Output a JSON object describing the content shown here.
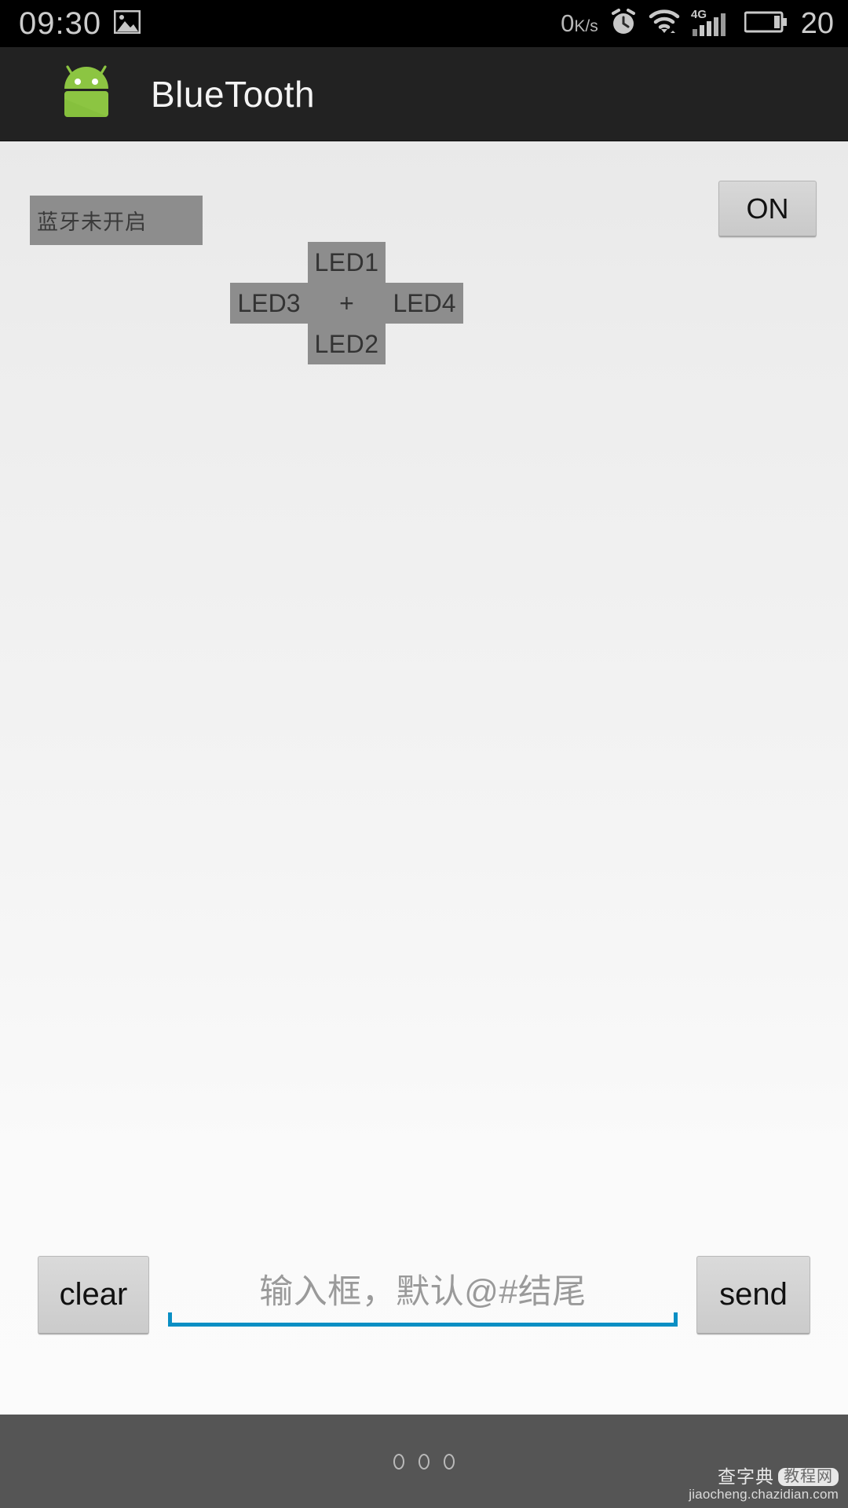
{
  "statusbar": {
    "clock": "09:30",
    "gallery_icon": "image-icon",
    "net_speed_value": "0",
    "net_speed_unit": "K/s",
    "alarm_icon": "alarm-clock-icon",
    "wifi_icon": "wifi-icon",
    "network_type": "4G",
    "signal_icon": "signal-bars-icon",
    "battery_icon": "battery-icon",
    "battery_level": "20"
  },
  "appbar": {
    "logo_icon": "android-robot-icon",
    "title": "BlueTooth"
  },
  "main": {
    "bluetooth_status": "蓝牙未开启",
    "power_button": "ON",
    "dpad": {
      "up": "LED1",
      "down": "LED2",
      "left": "LED3",
      "right": "LED4",
      "center": "+"
    }
  },
  "input_row": {
    "clear_button": "clear",
    "send_button": "send",
    "edit_placeholder": "输入框，默认@#结尾",
    "underline_color": "#0a8fc4"
  },
  "navbar": {
    "menu_icon": "three-dots-icon",
    "watermark_brand": "查字典",
    "watermark_badge": "教程网",
    "watermark_url": "jiaocheng.chazidian.com"
  }
}
